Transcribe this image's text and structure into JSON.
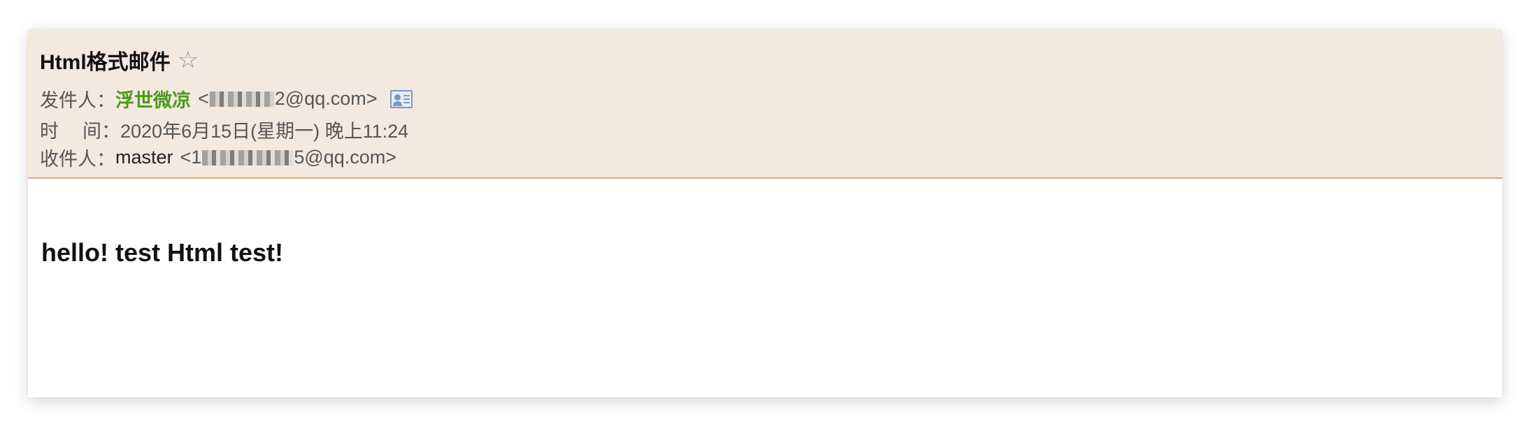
{
  "email": {
    "subject": "Html格式邮件",
    "star_icon": "star-outline-icon",
    "from": {
      "label": "发件人：",
      "name": "浮世微凉",
      "address_prefix": "<",
      "address_suffix": "2@qq.com>",
      "contact_icon": "contact-card-icon"
    },
    "time": {
      "label_first": "时",
      "label_second": "间：",
      "value": "2020年6月15日(星期一) 晚上11:24"
    },
    "to": {
      "label": "收件人：",
      "name": "master",
      "address_prefix": "<1",
      "address_suffix": "5@qq.com>"
    },
    "body": "hello! test Html test!"
  },
  "colors": {
    "header_bg": "#f4e9df",
    "header_border": "#d9a88c",
    "sender_name": "#4b9b1a"
  }
}
